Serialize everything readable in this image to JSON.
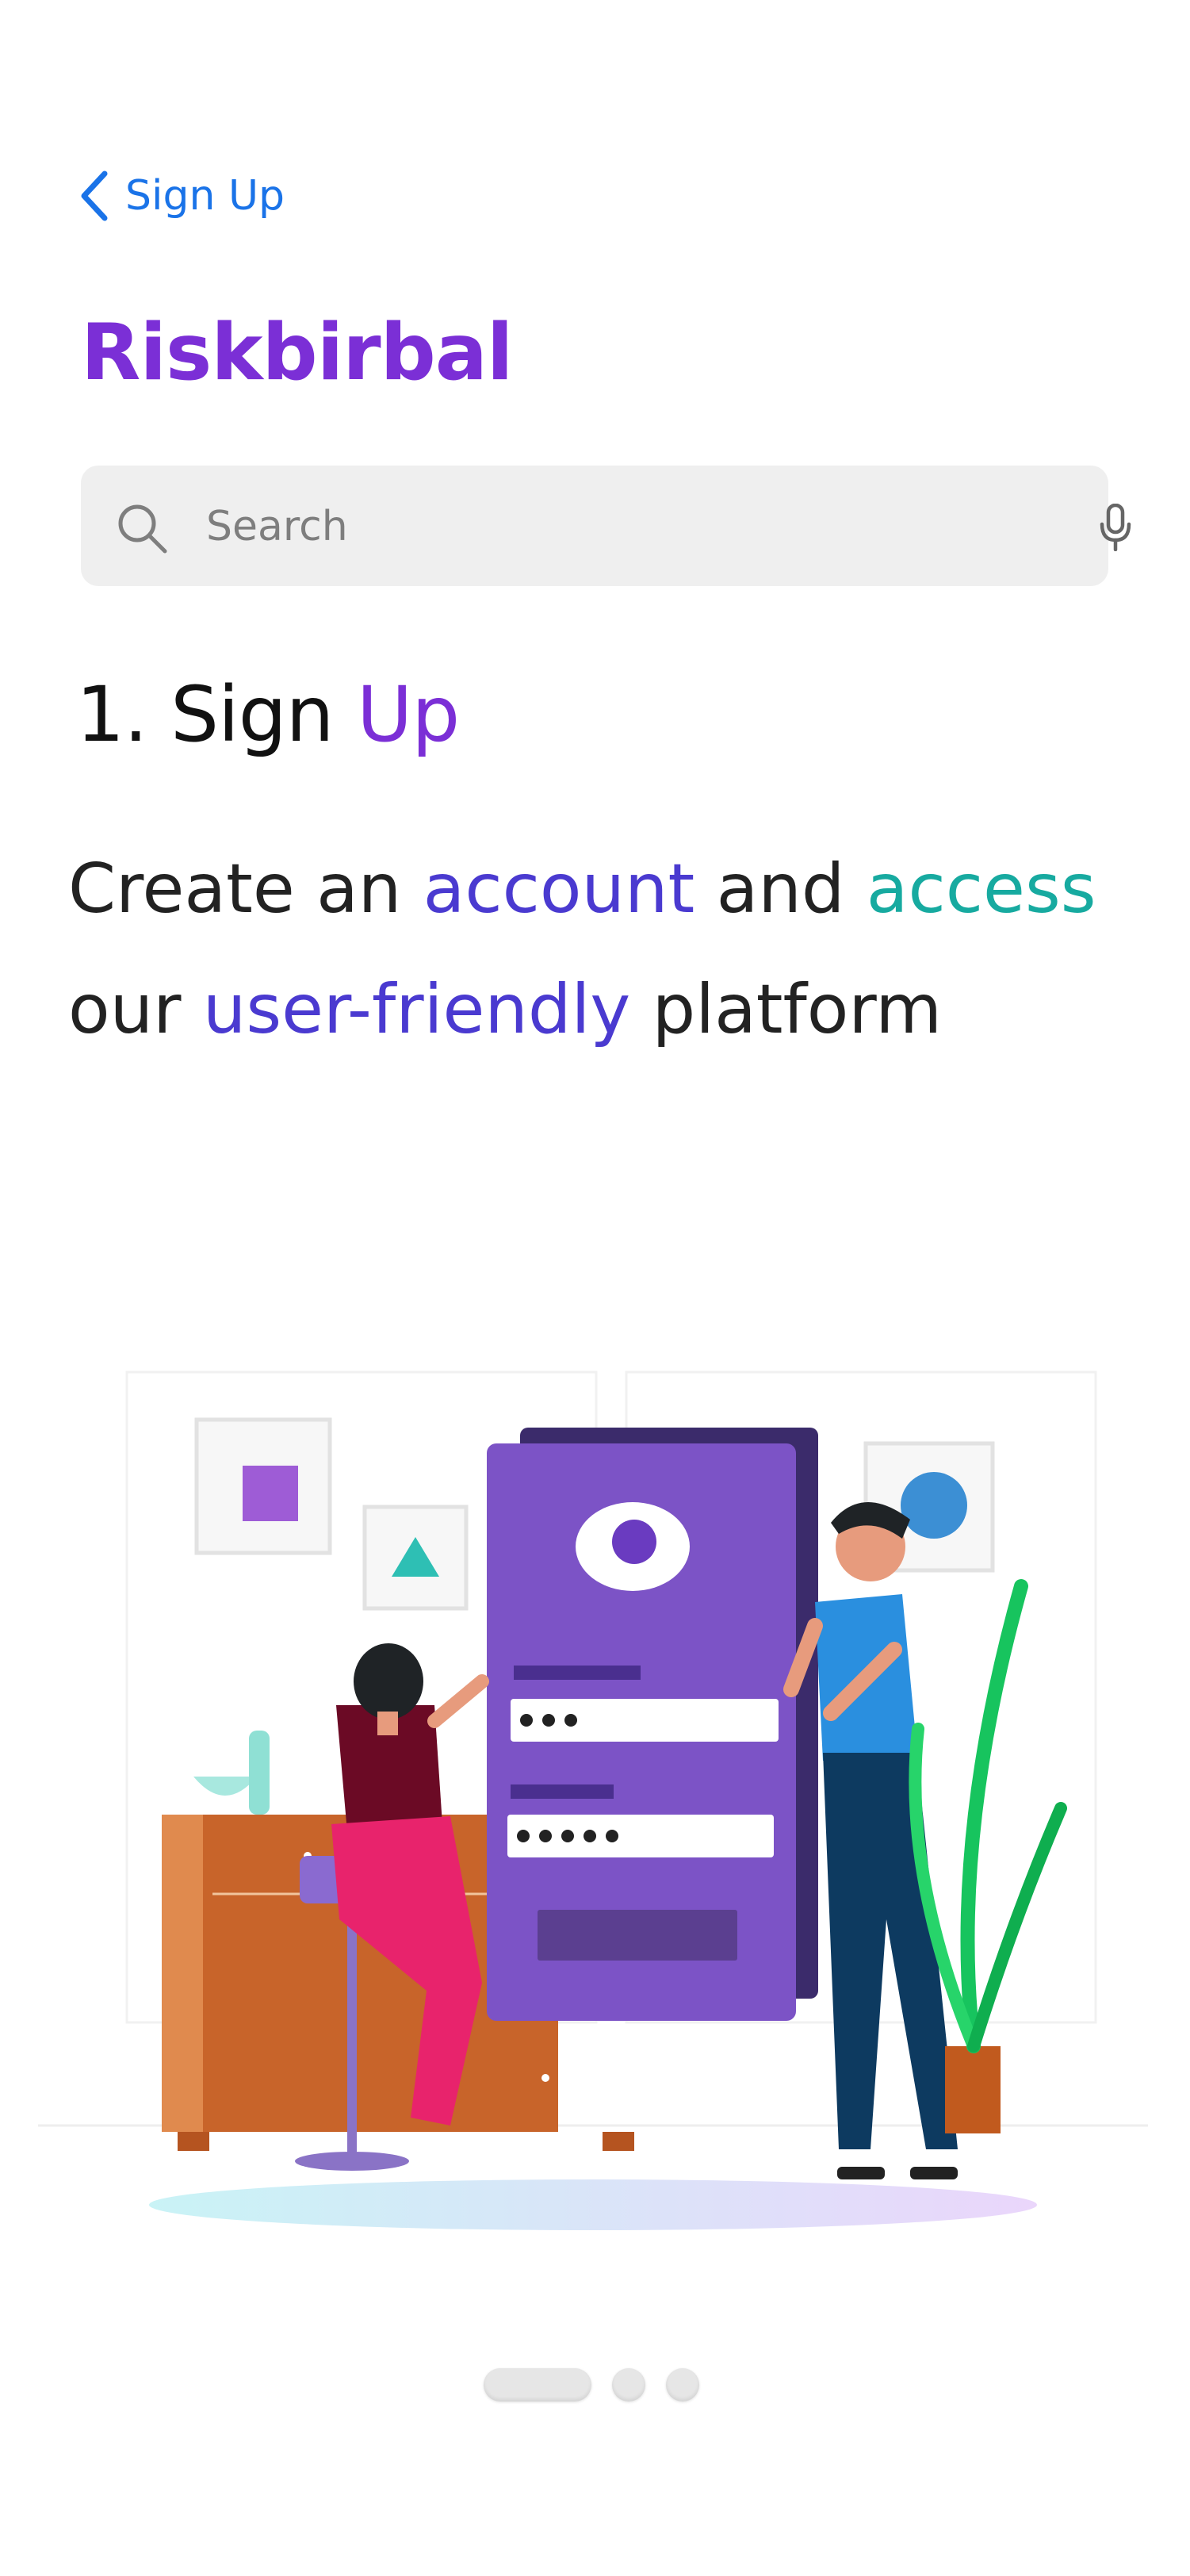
{
  "nav": {
    "back_label": "Sign Up"
  },
  "brand": {
    "name": "Riskbirbal"
  },
  "search": {
    "placeholder": "Search",
    "value": ""
  },
  "step": {
    "number_prefix": "1. Sign",
    "title_accent": "Up"
  },
  "description": {
    "part1": "Create an",
    "account": "account",
    "part2": "and",
    "access": "access",
    "part3": "our",
    "user_friendly": "user-friendly",
    "part4": "platform"
  },
  "pager": {
    "total": 3,
    "current": 1
  },
  "icons": {
    "back": "chevron-left-icon",
    "search": "search-icon",
    "mic": "microphone-icon"
  },
  "colors": {
    "brand": "#7b2fd6",
    "link": "#1a73e8",
    "accent_purple": "#4a3ad0",
    "accent_teal": "#17aaa0",
    "search_bg": "#efefef"
  }
}
